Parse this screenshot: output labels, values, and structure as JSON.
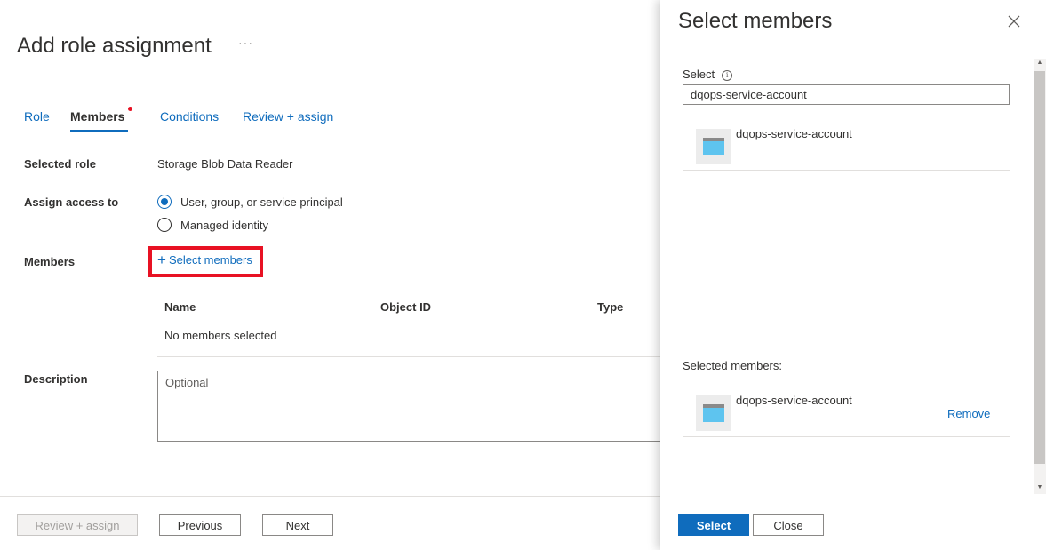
{
  "page": {
    "title": "Add role assignment",
    "more_options": "···",
    "tabs": [
      {
        "label": "Role",
        "active": false
      },
      {
        "label": "Members",
        "active": true
      },
      {
        "label": "Conditions",
        "active": false
      },
      {
        "label": "Review + assign",
        "active": false
      }
    ],
    "selected_role_label": "Selected role",
    "selected_role_value": "Storage Blob Data Reader",
    "assign_access_label": "Assign access to",
    "assign_options": [
      {
        "label": "User, group, or service principal",
        "checked": true
      },
      {
        "label": "Managed identity",
        "checked": false
      }
    ],
    "members_label": "Members",
    "select_members_link": "Select members",
    "table": {
      "headers": [
        "Name",
        "Object ID",
        "Type"
      ],
      "empty_text": "No members selected"
    },
    "description_label": "Description",
    "description_placeholder": "Optional",
    "footer": {
      "review_assign": "Review + assign",
      "previous": "Previous",
      "next": "Next"
    }
  },
  "panel": {
    "title": "Select members",
    "select_label": "Select",
    "search_value": "dqops-service-account",
    "results": [
      {
        "name": "dqops-service-account"
      }
    ],
    "selected_members_label": "Selected members:",
    "selected_members": [
      {
        "name": "dqops-service-account",
        "remove_label": "Remove"
      }
    ],
    "select_button": "Select",
    "close_button": "Close"
  },
  "colors": {
    "accent": "#0f6cbd",
    "highlight_box": "#e81123",
    "required_dot": "#e81123"
  },
  "icons": {
    "avatar": "service-principal-icon",
    "close": "close-icon",
    "info": "info-icon",
    "add": "plus-icon"
  }
}
